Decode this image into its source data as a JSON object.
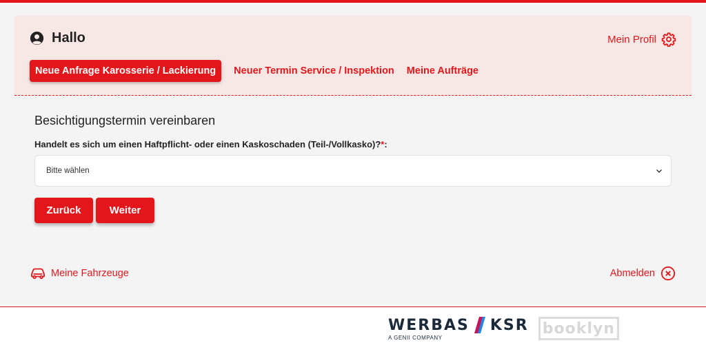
{
  "header": {
    "greeting": "Hallo",
    "profile_label": "Mein Profil",
    "nav": [
      {
        "label": "Neue Anfrage Karosserie / Lackierung",
        "active": true
      },
      {
        "label": "Neuer Termin Service / Inspektion",
        "active": false
      },
      {
        "label": "Meine Aufträge",
        "active": false
      }
    ]
  },
  "main": {
    "section_title": "Besichtigungstermin vereinbaren",
    "question": "Handelt es sich um einen Haftpflicht- oder einen Kaskoschaden (Teil-/Vollkasko)?",
    "required_mark": "*",
    "question_suffix": ":",
    "select": {
      "selected": "Bitte wählen"
    },
    "back_button": "Zurück",
    "next_button": "Weiter"
  },
  "bottom": {
    "vehicles_link": "Meine Fahrzeuge",
    "logout_link": "Abmelden"
  },
  "footer": {
    "werbas_part": "WERBAS",
    "ksr_part": "KSR",
    "tagline": "A GENII COMPANY",
    "booklyn": "booklyn"
  },
  "colors": {
    "accent": "#e3171b",
    "header_bg": "#f7e8e6",
    "page_bg": "#f4f4f4",
    "logo_dark": "#1b2a3a"
  },
  "icons": {
    "user": "user-circle-icon",
    "profile": "gear-icon",
    "vehicles": "car-icon",
    "logout": "close-circle-icon",
    "select": "chevron-down-icon"
  }
}
